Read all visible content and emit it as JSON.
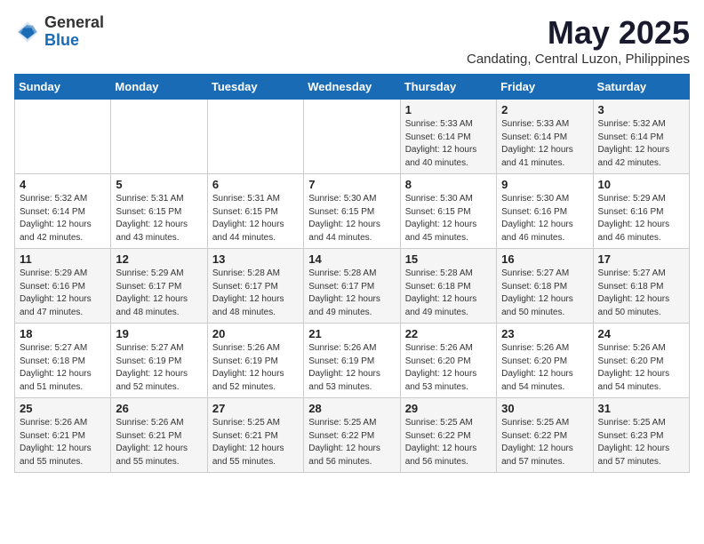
{
  "header": {
    "logo_general": "General",
    "logo_blue": "Blue",
    "month": "May 2025",
    "location": "Candating, Central Luzon, Philippines"
  },
  "weekdays": [
    "Sunday",
    "Monday",
    "Tuesday",
    "Wednesday",
    "Thursday",
    "Friday",
    "Saturday"
  ],
  "weeks": [
    [
      {
        "day": "",
        "info": ""
      },
      {
        "day": "",
        "info": ""
      },
      {
        "day": "",
        "info": ""
      },
      {
        "day": "",
        "info": ""
      },
      {
        "day": "1",
        "info": "Sunrise: 5:33 AM\nSunset: 6:14 PM\nDaylight: 12 hours\nand 40 minutes."
      },
      {
        "day": "2",
        "info": "Sunrise: 5:33 AM\nSunset: 6:14 PM\nDaylight: 12 hours\nand 41 minutes."
      },
      {
        "day": "3",
        "info": "Sunrise: 5:32 AM\nSunset: 6:14 PM\nDaylight: 12 hours\nand 42 minutes."
      }
    ],
    [
      {
        "day": "4",
        "info": "Sunrise: 5:32 AM\nSunset: 6:14 PM\nDaylight: 12 hours\nand 42 minutes."
      },
      {
        "day": "5",
        "info": "Sunrise: 5:31 AM\nSunset: 6:15 PM\nDaylight: 12 hours\nand 43 minutes."
      },
      {
        "day": "6",
        "info": "Sunrise: 5:31 AM\nSunset: 6:15 PM\nDaylight: 12 hours\nand 44 minutes."
      },
      {
        "day": "7",
        "info": "Sunrise: 5:30 AM\nSunset: 6:15 PM\nDaylight: 12 hours\nand 44 minutes."
      },
      {
        "day": "8",
        "info": "Sunrise: 5:30 AM\nSunset: 6:15 PM\nDaylight: 12 hours\nand 45 minutes."
      },
      {
        "day": "9",
        "info": "Sunrise: 5:30 AM\nSunset: 6:16 PM\nDaylight: 12 hours\nand 46 minutes."
      },
      {
        "day": "10",
        "info": "Sunrise: 5:29 AM\nSunset: 6:16 PM\nDaylight: 12 hours\nand 46 minutes."
      }
    ],
    [
      {
        "day": "11",
        "info": "Sunrise: 5:29 AM\nSunset: 6:16 PM\nDaylight: 12 hours\nand 47 minutes."
      },
      {
        "day": "12",
        "info": "Sunrise: 5:29 AM\nSunset: 6:17 PM\nDaylight: 12 hours\nand 48 minutes."
      },
      {
        "day": "13",
        "info": "Sunrise: 5:28 AM\nSunset: 6:17 PM\nDaylight: 12 hours\nand 48 minutes."
      },
      {
        "day": "14",
        "info": "Sunrise: 5:28 AM\nSunset: 6:17 PM\nDaylight: 12 hours\nand 49 minutes."
      },
      {
        "day": "15",
        "info": "Sunrise: 5:28 AM\nSunset: 6:18 PM\nDaylight: 12 hours\nand 49 minutes."
      },
      {
        "day": "16",
        "info": "Sunrise: 5:27 AM\nSunset: 6:18 PM\nDaylight: 12 hours\nand 50 minutes."
      },
      {
        "day": "17",
        "info": "Sunrise: 5:27 AM\nSunset: 6:18 PM\nDaylight: 12 hours\nand 50 minutes."
      }
    ],
    [
      {
        "day": "18",
        "info": "Sunrise: 5:27 AM\nSunset: 6:18 PM\nDaylight: 12 hours\nand 51 minutes."
      },
      {
        "day": "19",
        "info": "Sunrise: 5:27 AM\nSunset: 6:19 PM\nDaylight: 12 hours\nand 52 minutes."
      },
      {
        "day": "20",
        "info": "Sunrise: 5:26 AM\nSunset: 6:19 PM\nDaylight: 12 hours\nand 52 minutes."
      },
      {
        "day": "21",
        "info": "Sunrise: 5:26 AM\nSunset: 6:19 PM\nDaylight: 12 hours\nand 53 minutes."
      },
      {
        "day": "22",
        "info": "Sunrise: 5:26 AM\nSunset: 6:20 PM\nDaylight: 12 hours\nand 53 minutes."
      },
      {
        "day": "23",
        "info": "Sunrise: 5:26 AM\nSunset: 6:20 PM\nDaylight: 12 hours\nand 54 minutes."
      },
      {
        "day": "24",
        "info": "Sunrise: 5:26 AM\nSunset: 6:20 PM\nDaylight: 12 hours\nand 54 minutes."
      }
    ],
    [
      {
        "day": "25",
        "info": "Sunrise: 5:26 AM\nSunset: 6:21 PM\nDaylight: 12 hours\nand 55 minutes."
      },
      {
        "day": "26",
        "info": "Sunrise: 5:26 AM\nSunset: 6:21 PM\nDaylight: 12 hours\nand 55 minutes."
      },
      {
        "day": "27",
        "info": "Sunrise: 5:25 AM\nSunset: 6:21 PM\nDaylight: 12 hours\nand 55 minutes."
      },
      {
        "day": "28",
        "info": "Sunrise: 5:25 AM\nSunset: 6:22 PM\nDaylight: 12 hours\nand 56 minutes."
      },
      {
        "day": "29",
        "info": "Sunrise: 5:25 AM\nSunset: 6:22 PM\nDaylight: 12 hours\nand 56 minutes."
      },
      {
        "day": "30",
        "info": "Sunrise: 5:25 AM\nSunset: 6:22 PM\nDaylight: 12 hours\nand 57 minutes."
      },
      {
        "day": "31",
        "info": "Sunrise: 5:25 AM\nSunset: 6:23 PM\nDaylight: 12 hours\nand 57 minutes."
      }
    ]
  ]
}
